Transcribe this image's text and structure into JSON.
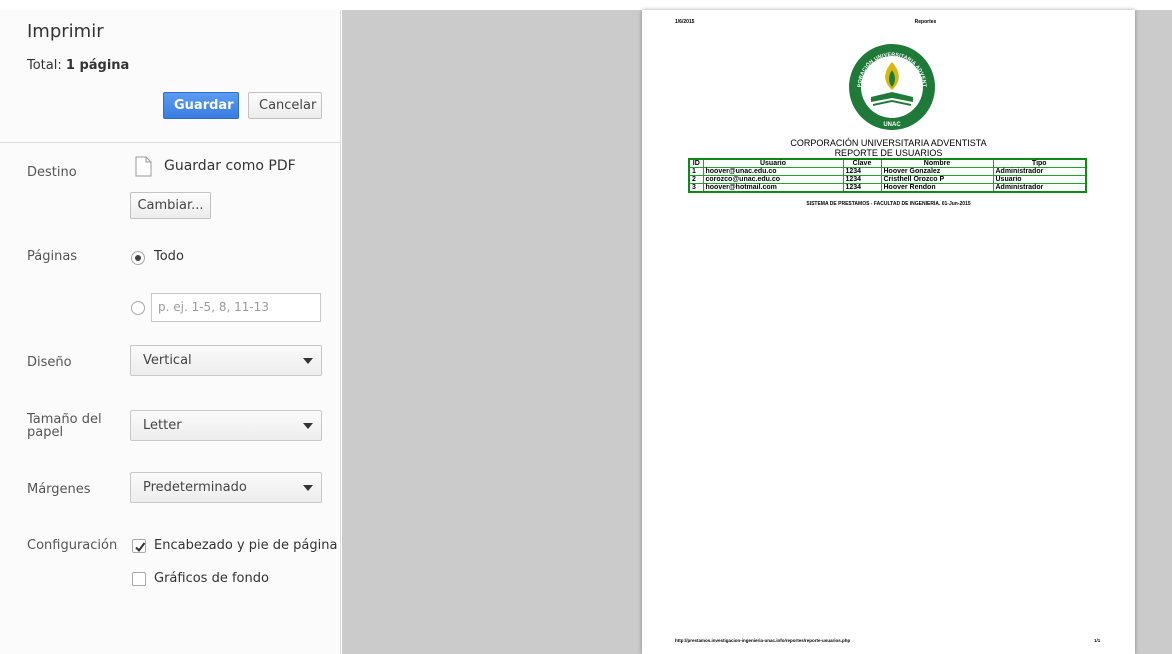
{
  "panel": {
    "title": "Imprimir",
    "total_label": "Total:",
    "total_value": "1 página",
    "save_label": "Guardar",
    "cancel_label": "Cancelar",
    "destination": {
      "label": "Destino",
      "value": "Guardar como PDF",
      "change_label": "Cambiar..."
    },
    "pages": {
      "label": "Páginas",
      "all_label": "Todo",
      "custom_placeholder": "p. ej. 1-5, 8, 11-13"
    },
    "layout": {
      "label": "Diseño",
      "value": "Vertical"
    },
    "paper_size": {
      "label": "Tamaño del papel",
      "value": "Letter"
    },
    "margins": {
      "label": "Márgenes",
      "value": "Predeterminado"
    },
    "options": {
      "label": "Configuración",
      "headers_footers": "Encabezado y pie de página",
      "background_graphics": "Gráficos de fondo"
    }
  },
  "preview": {
    "header_date": "1/6/2015",
    "header_title": "Reportes",
    "logo_arc_top": "CORPORACIÓN UNIVERSITARIA ADVENTISTA",
    "logo_bottom": "UNAC",
    "heading": "CORPORACIÓN UNIVERSITARIA ADVENTISTA",
    "subheading": "REPORTE DE USUARIOS",
    "table": {
      "headers": [
        "ID",
        "Usuario",
        "Clave",
        "Nombre",
        "Tipo"
      ],
      "rows": [
        [
          "1",
          "hoover@unac.edu.co",
          "1234",
          "Hoover Gonzalez",
          "Administrador"
        ],
        [
          "2",
          "corozco@unac.edu.co",
          "1234",
          "Cristhell Orozco P",
          "Usuario"
        ],
        [
          "3",
          "hoover@hotmail.com",
          "1234",
          "Hoover Rendon",
          "Administrador"
        ]
      ]
    },
    "footer_note": "SISTEMA DE PRESTAMOS - FACULTAD DE INGENIERIA. 01-Jun-2015",
    "url": "http://prestamos.investigacion-ingenieria-unac.info/reportes/reporte-usuarios.php",
    "page_counter": "1/1"
  },
  "colors": {
    "primary_button": "#3a7de0",
    "table_border": "#0e8a19",
    "logo_green": "#1f7a3a",
    "logo_gold": "#d6b80e"
  }
}
